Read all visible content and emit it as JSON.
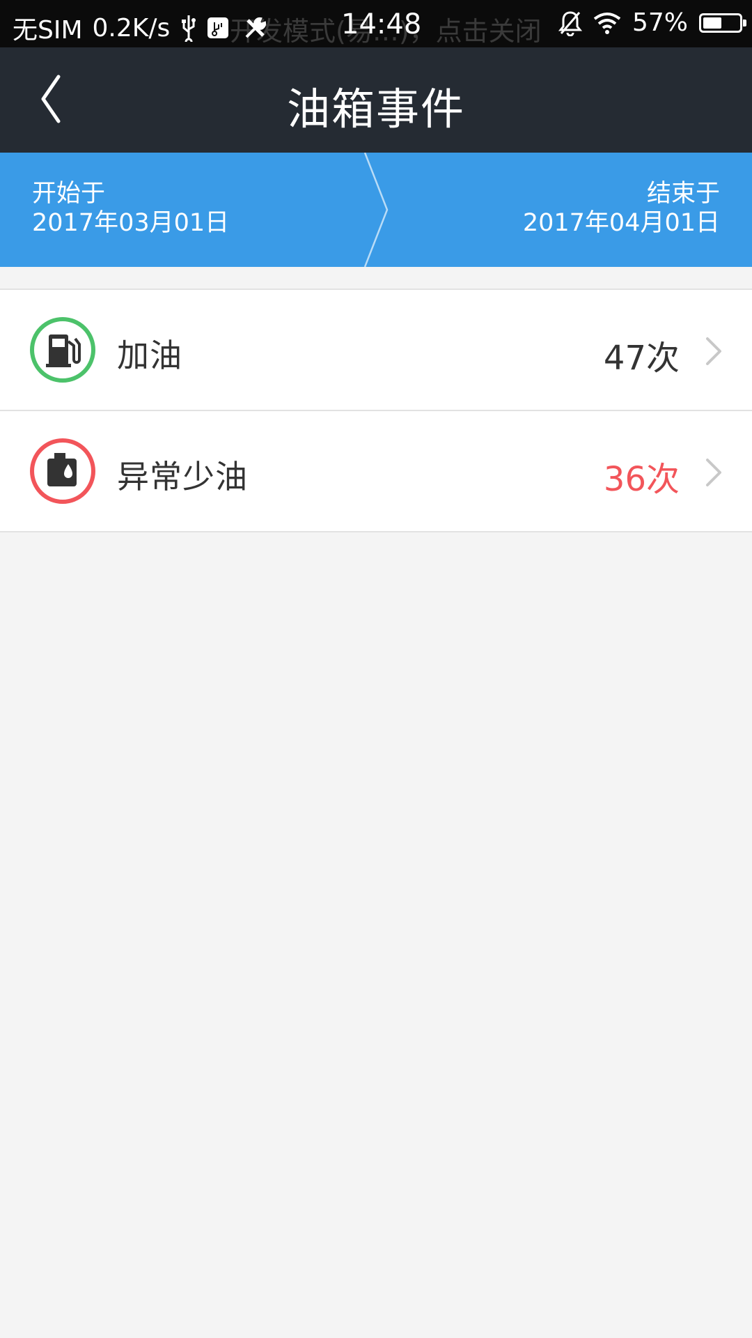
{
  "status_bar": {
    "carrier": "无SIM",
    "speed": "0.2K/s",
    "background_notice": "开发模式(易…)，点击关闭",
    "time": "14:48",
    "battery": "57%",
    "battery_level": 0.57,
    "icons": [
      "usb-icon",
      "sd-card-icon",
      "tools-icon",
      "bell-off-icon",
      "wifi-icon",
      "battery-icon"
    ]
  },
  "nav": {
    "title": "油箱事件",
    "back_icon": "chevron-left-icon"
  },
  "date_range": {
    "start_label": "开始于",
    "start_date": "2017年03月01日",
    "end_label": "结束于",
    "end_date": "2017年04月01日"
  },
  "events": [
    {
      "label": "加油",
      "count": "47次",
      "icon": "fuel-pump-icon",
      "icon_color": "#4cc26a",
      "count_color": "#333333"
    },
    {
      "label": "异常少油",
      "count": "36次",
      "icon": "fuel-tank-drop-icon",
      "icon_color": "#f2555a",
      "count_color": "#f2555a"
    }
  ],
  "colors": {
    "nav_bg": "#252b33",
    "date_bar_bg": "#3a9be7",
    "page_bg": "#f4f4f4",
    "refuel": "#4cc26a",
    "warning": "#f2555a"
  }
}
